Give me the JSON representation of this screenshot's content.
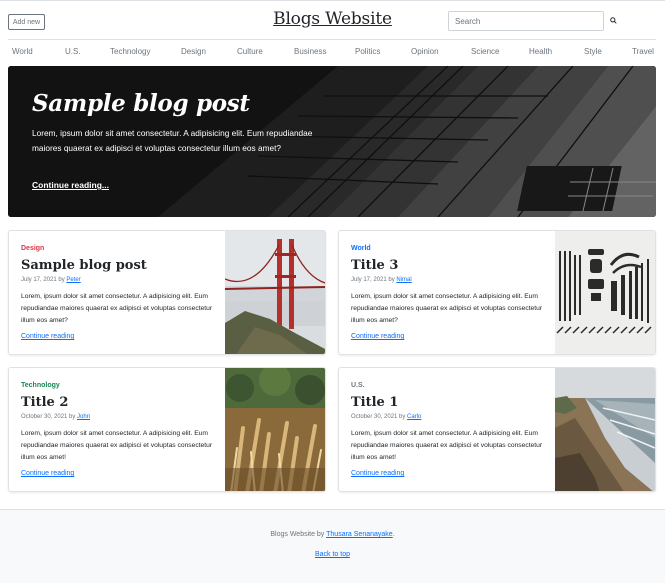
{
  "header": {
    "add_label": "Add new",
    "site_title": "Blogs Website",
    "search_placeholder": "Search",
    "search_icon": "search-icon"
  },
  "nav": {
    "items": [
      "World",
      "U.S.",
      "Technology",
      "Design",
      "Culture",
      "Business",
      "Politics",
      "Opinion",
      "Science",
      "Health",
      "Style",
      "Travel"
    ]
  },
  "hero": {
    "title": "Sample blog post",
    "text": "Lorem, ipsum dolor sit amet consectetur. A adipisicing elit. Eum repudiandae maiores quaerat ex adipisci et voluptas consectetur illum eos amet?",
    "link": "Continue reading..."
  },
  "cards": [
    {
      "category": "Design",
      "category_color": "#dc3545",
      "title": "Sample blog post",
      "date": "July 17, 2021 by",
      "author": "Peter",
      "excerpt": "Lorem, ipsum dolor sit amet consectetur. A adipisicing elit. Eum repudiandae maiores quaerat ex adipisci et voluptas consectetur illum eos amet?",
      "more": "Continue reading",
      "image": "golden-gate-bridge"
    },
    {
      "category": "World",
      "category_color": "#0d6efd",
      "title": "Title 3",
      "date": "July 17, 2021 by",
      "author": "Nimal",
      "excerpt": "Lorem, ipsum dolor sit amet consectetur. A adipisicing elit. Eum repudiandae maiores quaerat ex adipisci et voluptas consectetur illum eos amet?",
      "more": "Continue reading",
      "image": "tools-flatlay"
    },
    {
      "category": "Technology",
      "category_color": "#198754",
      "title": "Title 2",
      "date": "October 30, 2021 by",
      "author": "John",
      "excerpt": "Lorem, ipsum dolor sit amet consectetur. A adipisicing elit. Eum repudiandae maiores quaerat ex adipisci et voluptas consectetur illum eos amet!",
      "more": "Continue reading",
      "image": "wheat-field"
    },
    {
      "category": "U.S.",
      "category_color": "#6c757d",
      "title": "Title 1",
      "date": "October 30, 2021 by",
      "author": "Carlo",
      "excerpt": "Lorem, ipsum dolor sit amet consectetur. A adipisicing elit. Eum repudiandae maiores quaerat ex adipisci et voluptas consectetur illum eos amet!",
      "more": "Continue reading",
      "image": "coastal-cliff"
    }
  ],
  "footer": {
    "credit_prefix": "Blogs Website by",
    "credit_author": "Thusara Senanayake",
    "credit_suffix": ".",
    "back_to_top": "Back to top"
  },
  "colors": {
    "link": "#0d6efd",
    "muted": "#6c757d"
  }
}
